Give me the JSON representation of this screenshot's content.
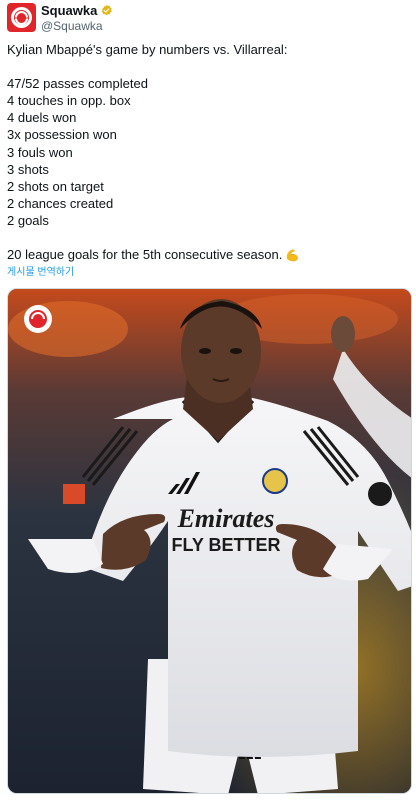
{
  "account": {
    "display_name": "Squawka",
    "handle": "@Squawka",
    "verified_icon": "verified-badge-icon",
    "brand_color": "#e0262a"
  },
  "tweet": {
    "lines": [
      "Kylian Mbappé's game by numbers vs. Villarreal:",
      "",
      "47/52 passes completed",
      "4 touches in opp. box",
      "4 duels won",
      "3x possession won",
      "3 fouls won",
      "3 shots",
      "2 shots on target",
      "2 chances created",
      "2 goals",
      "",
      "20 league goals for the 5th consecutive season."
    ],
    "emoji": "flexed-biceps-icon",
    "translate_label": "게시물 번역하기"
  },
  "media": {
    "type": "photo",
    "jersey_sponsor_line1": "Emirates",
    "jersey_sponsor_line2": "FLY BETTER"
  }
}
